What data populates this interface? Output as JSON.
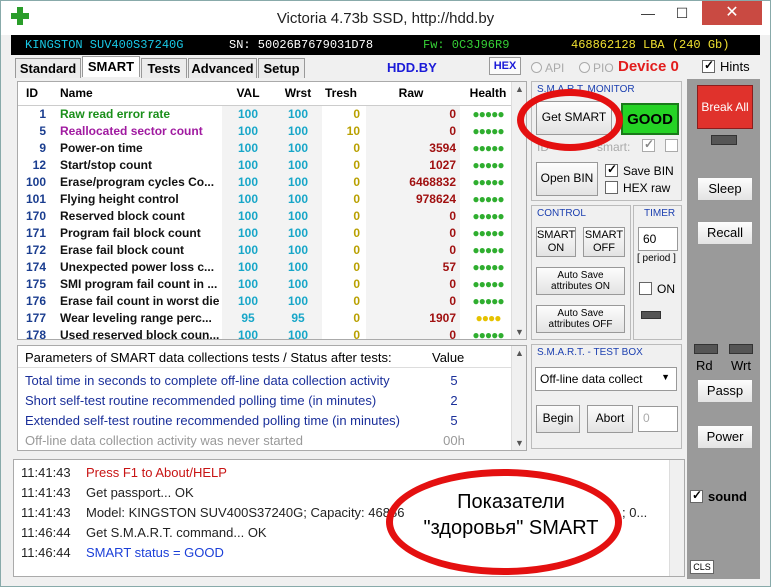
{
  "window": {
    "title": "Victoria 4.73b SSD, http://hdd.by",
    "minimize": "—",
    "maximize": "☐",
    "close": "✕"
  },
  "infobar": {
    "model": "KINGSTON SUV400S37240G",
    "sn": "SN: 50026B7679031D78",
    "fw": "Fw: 0C3J96R9",
    "lba": "468862128 LBA (240 Gb)"
  },
  "tabs": [
    {
      "label": "Standard"
    },
    {
      "label": "SMART"
    },
    {
      "label": "Tests"
    },
    {
      "label": "Advanced"
    },
    {
      "label": "Setup"
    }
  ],
  "toolbar": {
    "hdd_by": "HDD.BY",
    "hex": "HEX",
    "api": "API",
    "pio": "PIO",
    "device": "Device 0",
    "hints": "Hints"
  },
  "smart": {
    "headers": {
      "id": "ID",
      "name": "Name",
      "val": "VAL",
      "wrst": "Wrst",
      "tresh": "Tresh",
      "raw": "Raw",
      "health": "Health"
    },
    "rows": [
      {
        "id": "1",
        "name": "Raw read error rate",
        "val": "100",
        "wrst": "100",
        "tresh": "0",
        "raw": "0",
        "health": "●●●●●",
        "color": "#1a8f1a"
      },
      {
        "id": "5",
        "name": "Reallocated sector count",
        "val": "100",
        "wrst": "100",
        "tresh": "10",
        "raw": "0",
        "health": "●●●●●",
        "color": "#a01aa0"
      },
      {
        "id": "9",
        "name": "Power-on time",
        "val": "100",
        "wrst": "100",
        "tresh": "0",
        "raw": "3594",
        "health": "●●●●●",
        "color": "#111111"
      },
      {
        "id": "12",
        "name": "Start/stop count",
        "val": "100",
        "wrst": "100",
        "tresh": "0",
        "raw": "1027",
        "health": "●●●●●",
        "color": "#111111"
      },
      {
        "id": "100",
        "name": "Erase/program cycles Co...",
        "val": "100",
        "wrst": "100",
        "tresh": "0",
        "raw": "6468832",
        "health": "●●●●●",
        "color": "#111111"
      },
      {
        "id": "101",
        "name": "Flying height control",
        "val": "100",
        "wrst": "100",
        "tresh": "0",
        "raw": "978624",
        "health": "●●●●●",
        "color": "#111111"
      },
      {
        "id": "170",
        "name": "Reserved block count",
        "val": "100",
        "wrst": "100",
        "tresh": "0",
        "raw": "0",
        "health": "●●●●●",
        "color": "#111111"
      },
      {
        "id": "171",
        "name": "Program fail block count",
        "val": "100",
        "wrst": "100",
        "tresh": "0",
        "raw": "0",
        "health": "●●●●●",
        "color": "#111111"
      },
      {
        "id": "172",
        "name": "Erase fail block count",
        "val": "100",
        "wrst": "100",
        "tresh": "0",
        "raw": "0",
        "health": "●●●●●",
        "color": "#111111"
      },
      {
        "id": "174",
        "name": "Unexpected power loss c...",
        "val": "100",
        "wrst": "100",
        "tresh": "0",
        "raw": "57",
        "health": "●●●●●",
        "color": "#111111"
      },
      {
        "id": "175",
        "name": "SMI program fail count in ...",
        "val": "100",
        "wrst": "100",
        "tresh": "0",
        "raw": "0",
        "health": "●●●●●",
        "color": "#111111"
      },
      {
        "id": "176",
        "name": "Erase fail count in worst die",
        "val": "100",
        "wrst": "100",
        "tresh": "0",
        "raw": "0",
        "health": "●●●●●",
        "color": "#111111"
      },
      {
        "id": "177",
        "name": "Wear leveling range perc...",
        "val": "95",
        "wrst": "95",
        "tresh": "0",
        "raw": "1907",
        "health": "●●●●",
        "color": "#111111",
        "health_color": "#e6c200"
      },
      {
        "id": "178",
        "name": "Used reserved block coun...",
        "val": "100",
        "wrst": "100",
        "tresh": "0",
        "raw": "0",
        "health": "●●●●●",
        "color": "#111111"
      }
    ]
  },
  "params": {
    "header_title": "Parameters of SMART data collections tests / Status after tests:",
    "header_value": "Value",
    "rows": [
      {
        "text": "Total time in seconds to complete off-line data collection activity",
        "value": "5"
      },
      {
        "text": "Short self-test routine recommended polling time (in minutes)",
        "value": "2"
      },
      {
        "text": "Extended self-test routine recommended polling time (in minutes)",
        "value": "5"
      },
      {
        "text": "Off-line data collection activity was never started",
        "value": "00h",
        "dim": true
      }
    ]
  },
  "log": [
    {
      "time": "11:41:43",
      "msg": "Press F1 to About/HELP",
      "color": "#c81414"
    },
    {
      "time": "11:41:43",
      "msg": "Get passport... OK",
      "color": "#222222"
    },
    {
      "time": "11:41:43",
      "msg": "Model: KINGSTON SUV400S37240G; Capacity: 46886",
      "color": "#222222",
      "tail": "; 0..."
    },
    {
      "time": "11:46:44",
      "msg": "Get S.M.A.R.T. command... OK",
      "color": "#222222"
    },
    {
      "time": "11:46:44",
      "msg": "SMART status = GOOD",
      "color": "#1b3fd8"
    }
  ],
  "smart_monitor": {
    "title": "S.M.A.R.T. MONITOR",
    "get_smart": "Get SMART",
    "status": "GOOD",
    "id_label": "ID",
    "smart_label": "smart:",
    "open_bin": "Open BIN",
    "save_bin": "Save BIN",
    "hex_raw": "HEX raw"
  },
  "control": {
    "title": "CONTROL",
    "smart_on": "SMART ON",
    "smart_off": "SMART OFF",
    "autosave_on": "Auto Save attributes ON",
    "autosave_off": "Auto Save attributes OFF"
  },
  "timer": {
    "title": "TIMER",
    "value": "60",
    "period": "[ period ]",
    "on": "ON"
  },
  "testbox": {
    "title": "S.M.A.R.T. - TEST BOX",
    "selected": "Off-line data collect",
    "begin": "Begin",
    "abort": "Abort",
    "value": "0"
  },
  "sidebar": {
    "break_all": "Break All",
    "sleep": "Sleep",
    "recall": "Recall",
    "rd": "Rd",
    "wrt": "Wrt",
    "passp": "Passp",
    "power": "Power",
    "sound": "sound",
    "cls": "CLS"
  },
  "annotation": {
    "text": "Показатели \"здоровья\" SMART",
    "color": "#e41010"
  }
}
